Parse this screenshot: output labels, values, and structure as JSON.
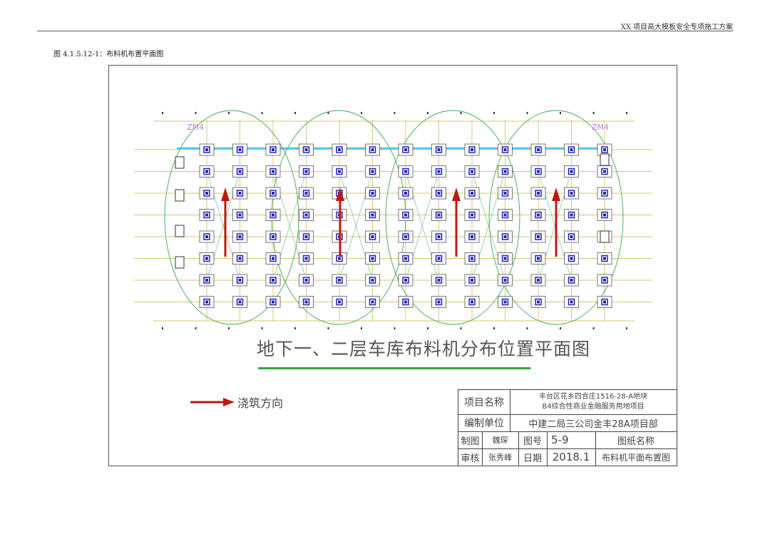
{
  "header": {
    "doc_title": "XX 项目高大模板安全专项施工方案"
  },
  "caption": "图 4.1.5.12-1：布料机布置平面图",
  "drawing": {
    "title": "地下一、二层车库布料机分布位置平面图",
    "zone_labels": [
      "ZM4",
      "ZM4"
    ],
    "legend_label": "浇筑方向",
    "colors": {
      "arrow": "#c0180f",
      "ring": "#3aa84a",
      "grid": "#c8b24a",
      "column": "#2424b8",
      "beam": "#46c4e0",
      "underline": "#2ca83c"
    }
  },
  "title_block": {
    "project_name_label": "项目名称",
    "project_name_line1": "丰台区花乡四合庄1516-28-A地块",
    "project_name_line2": "B4综合性商业金融服务用地项目",
    "unit_label": "编制单位",
    "unit_value": "中建二局三公司金丰28A项目部",
    "drawn_label": "制图",
    "drawn_value": "魏琛",
    "drawing_no_label": "图号",
    "drawing_no_value": "5-9",
    "drawing_name_label": "图纸名称",
    "checked_label": "审核",
    "checked_value": "张秀峰",
    "date_label": "日期",
    "date_value": "2018.1",
    "drawing_name_value": "布料机平面布置图"
  }
}
